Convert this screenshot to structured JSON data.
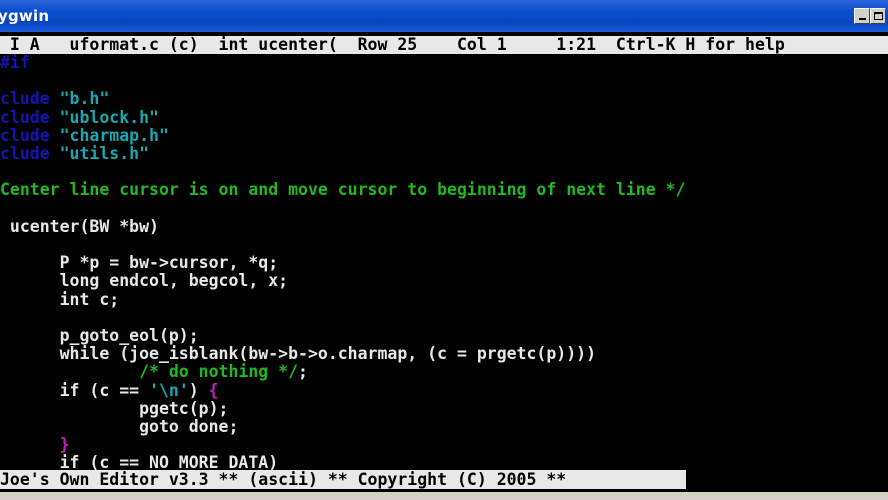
{
  "window": {
    "title": "ygwin"
  },
  "status_bar": {
    "text": " I A   uformat.c (c)  int ucenter(  Row 25    Col 1     1:21  Ctrl-K H for help"
  },
  "code_lines": [
    [
      {
        "t": "#if",
        "c": "kw-dark"
      }
    ],
    [],
    [
      {
        "t": "clude ",
        "c": "kw-dark"
      },
      {
        "t": "\"b.h\"",
        "c": "str"
      }
    ],
    [
      {
        "t": "clude ",
        "c": "kw-dark"
      },
      {
        "t": "\"ublock.h\"",
        "c": "str"
      }
    ],
    [
      {
        "t": "clude ",
        "c": "kw-dark"
      },
      {
        "t": "\"charmap.h\"",
        "c": "str"
      }
    ],
    [
      {
        "t": "clude ",
        "c": "kw-dark"
      },
      {
        "t": "\"utils.h\"",
        "c": "str"
      }
    ],
    [],
    [
      {
        "t": "Center line cursor is on and move cursor to beginning of next line */",
        "c": "cmt"
      }
    ],
    [],
    [
      {
        "t": " ucenter(BW *bw)",
        "c": ""
      }
    ],
    [],
    [
      {
        "t": "      P *p = bw->cursor, *q;",
        "c": ""
      }
    ],
    [
      {
        "t": "      long endcol, begcol, x;",
        "c": ""
      }
    ],
    [
      {
        "t": "      int c;",
        "c": ""
      }
    ],
    [],
    [
      {
        "t": "      p_goto_eol(p);",
        "c": ""
      }
    ],
    [
      {
        "t": "      while (joe_isblank(bw->b->o.charmap, (c = prgetc(p))))",
        "c": ""
      }
    ],
    [
      {
        "t": "              ",
        "c": ""
      },
      {
        "t": "/* do nothing */",
        "c": "cmt"
      },
      {
        "t": ";",
        "c": ""
      }
    ],
    [
      {
        "t": "      if (c == ",
        "c": ""
      },
      {
        "t": "'\\n'",
        "c": "str"
      },
      {
        "t": ") ",
        "c": ""
      },
      {
        "t": "{",
        "c": "mag"
      }
    ],
    [
      {
        "t": "              pgetc(p);",
        "c": ""
      }
    ],
    [
      {
        "t": "              goto done;",
        "c": ""
      }
    ],
    [
      {
        "t": "      ",
        "c": ""
      },
      {
        "t": "}",
        "c": "mag"
      }
    ],
    [
      {
        "t": "      if (c == NO_MORE_DATA)",
        "c": ""
      }
    ]
  ],
  "bottom_status": {
    "text": "Joe's Own Editor v3.3 ** (ascii) ** Copyright (C) 2005 **"
  }
}
